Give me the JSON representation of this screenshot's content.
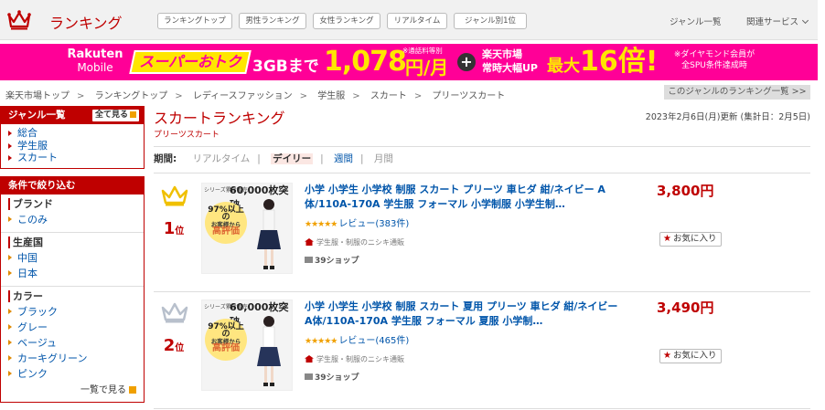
{
  "header": {
    "brand": "ランキング",
    "pills": [
      "ランキングトップ",
      "男性ランキング",
      "女性ランキング",
      "リアルタイム",
      "ジャンル別1位"
    ],
    "genre_link": "ジャンル一覧",
    "service_link": "関連サービス"
  },
  "banner": {
    "logo_top": "Rakuten",
    "logo_bottom": "Mobile",
    "otoku": "スーパーおトク",
    "gb": "3GBまで",
    "price": "1,078",
    "note1": "※通話料等別",
    "yen": "円/月",
    "plus": "+",
    "ichiba1": "楽天市場",
    "ichiba2": "常時大幅UP",
    "max": "最大",
    "times": "16倍!",
    "note2a": "※ダイヤモンド会員が",
    "note2b": "全SPU条件達成時"
  },
  "breadcrumb": [
    "楽天市場トップ",
    "ランキングトップ",
    "レディースファッション",
    "学生服",
    "スカート",
    "プリーツスカート"
  ],
  "breadcrumb_right": "このジャンルのランキング一覧 >>",
  "sidebar": {
    "genre_title": "ジャンル一覧",
    "all_label": "全て見る",
    "genres": [
      "総合",
      "学生服",
      "スカート"
    ],
    "filter_title": "条件で絞り込む",
    "groups": [
      {
        "title": "ブランド",
        "items": [
          "このみ"
        ]
      },
      {
        "title": "生産国",
        "items": [
          "中国",
          "日本"
        ]
      },
      {
        "title": "カラー",
        "items": [
          "ブラック",
          "グレー",
          "ベージュ",
          "カーキグリーン",
          "ピンク"
        ]
      }
    ],
    "more_label": "一覧で見る"
  },
  "main": {
    "title": "スカートランキング",
    "subtitle": "プリーツスカート",
    "updated": "2023年2月6日(月)更新 (集計日：2月5日)",
    "period_label": "期間:",
    "tabs": [
      "リアルタイム",
      "デイリー",
      "週間",
      "月間"
    ],
    "active_tab": "デイリー"
  },
  "items": [
    {
      "rank": "1",
      "rank_suffix": "位",
      "crown_color": "#f0c000",
      "title": "小学 小学生 小学校 制服 スカート プリーツ 車ヒダ 紺/ネイビー A体/110A-170A 学生服 フォーマル 小学制服 小学生制…",
      "stars": "★★★★★",
      "review": "レビュー(383件)",
      "shop": "学生服・制服のニシキ通販",
      "s39": "39ショップ",
      "price": "3,800円",
      "fav": "お気に入り",
      "thumb_small": "シリーズ累計販売",
      "thumb_big": "60,000枚突破",
      "thumb_c1": "97%以上の",
      "thumb_c2": "お客様から",
      "thumb_c3": "高評価"
    },
    {
      "rank": "2",
      "rank_suffix": "位",
      "crown_color": "#b8c0cc",
      "title": "小学 小学生 小学校 制服 スカート 夏用 プリーツ 車ヒダ 紺/ネイビー A体/110A-170A 学生服 フォーマル 夏服 小学制…",
      "stars": "★★★★★",
      "review": "レビュー(465件)",
      "shop": "学生服・制服のニシキ通販",
      "s39": "39ショップ",
      "price": "3,490円",
      "fav": "お気に入り",
      "thumb_small": "シリーズ累計販売",
      "thumb_big": "60,000枚突破",
      "thumb_c1": "97%以上の",
      "thumb_c2": "お客様から",
      "thumb_c3": "高評価"
    }
  ]
}
